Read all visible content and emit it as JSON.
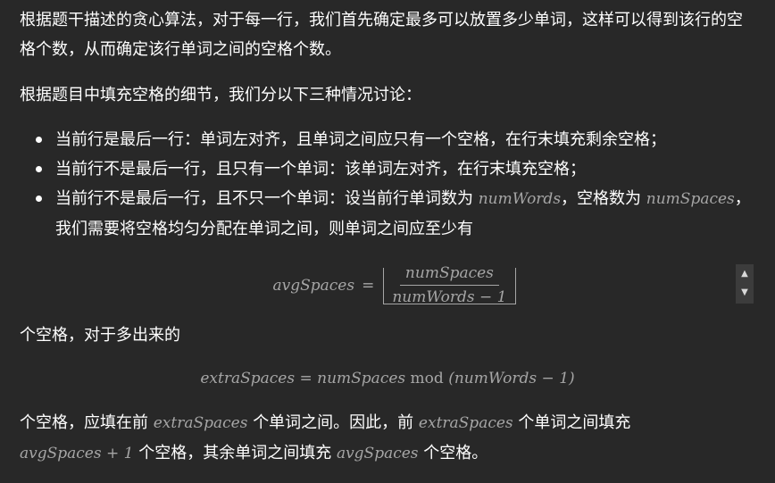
{
  "intro": {
    "p1": "根据题干描述的贪心算法，对于每一行，我们首先确定最多可以放置多少单词，这样可以得到该行的空格个数，从而确定该行单词之间的空格个数。",
    "p2": "根据题目中填充空格的细节，我们分以下三种情况讨论："
  },
  "cases": {
    "c1": "当前行是最后一行：单词左对齐，且单词之间应只有一个空格，在行末填充剩余空格；",
    "c2": "当前行不是最后一行，且只有一个单词：该单词左对齐，在行末填充空格；",
    "c3_a": "当前行不是最后一行，且不只一个单词：设当前行单词数为",
    "c3_var1": "numWords",
    "c3_b": "，空格数为",
    "c3_var2": "numSpaces",
    "c3_c": "，我们需要将空格均匀分配在单词之间，则单词之间应至少有"
  },
  "formula1": {
    "lhs": "avgSpaces",
    "eq": "=",
    "numerator": "numSpaces",
    "denominator": "numWords − 1"
  },
  "after1": "个空格，对于多出来的",
  "formula2": {
    "lhs": "extraSpaces",
    "eq": "=",
    "a": "numSpaces",
    "op": "mod",
    "b": "(numWords − 1)"
  },
  "final": {
    "t1": "个空格，应填在前",
    "v1": "extraSpaces",
    "t2": "个单词之间。因此，前",
    "v2": "extraSpaces",
    "t3": "个单词之间填充",
    "v3": "avgSpaces + 1",
    "t4": "个空格，其余单词之间填充",
    "v4": "avgSpaces",
    "t5": "个空格。"
  },
  "scrollbar": {
    "up_icon": "triangle-up-icon",
    "down_icon": "triangle-down-icon"
  }
}
